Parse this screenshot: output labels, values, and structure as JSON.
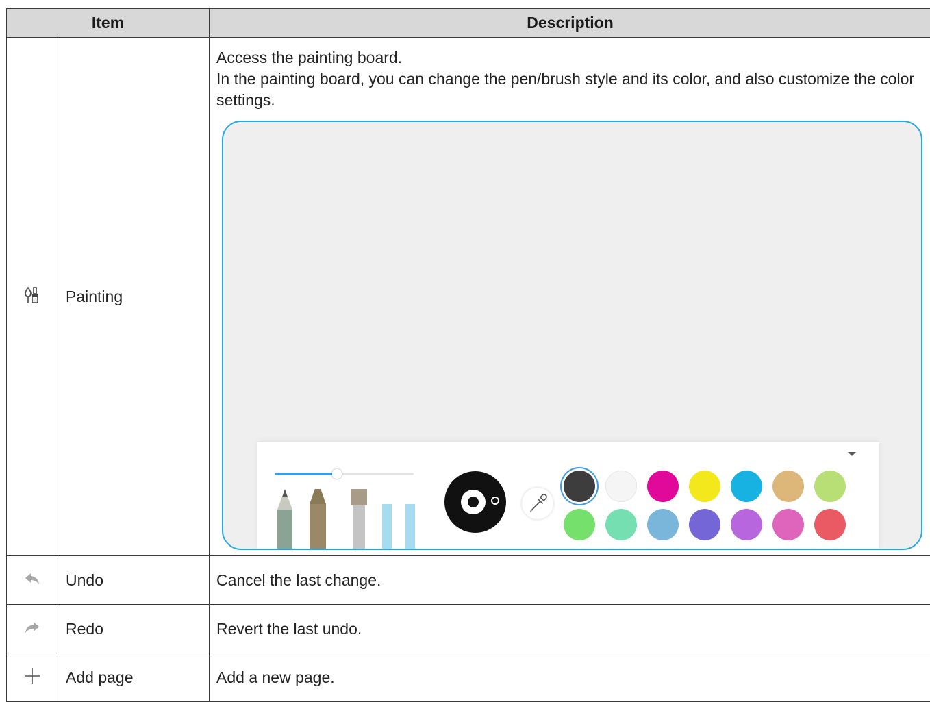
{
  "table": {
    "header": {
      "item": "Item",
      "description": "Description"
    },
    "rows": [
      {
        "icon": "painting-icon",
        "name": "Painting",
        "description_lines": [
          "Access the painting board.",
          "In the painting board, you can change the pen/brush style and its color, and also customize the color settings."
        ]
      },
      {
        "icon": "undo-icon",
        "name": "Undo",
        "description": "Cancel the last change."
      },
      {
        "icon": "redo-icon",
        "name": "Redo",
        "description": "Revert the last undo."
      },
      {
        "icon": "add-page-icon",
        "name": "Add page",
        "description": "Add a new page."
      }
    ]
  },
  "painting_board": {
    "stroke_size_level": 0.45,
    "selected_color": "#3d3d3d",
    "colors": [
      "#3d3d3d",
      "#f5f5f5",
      "#e0099a",
      "#f3e81c",
      "#18b2e2",
      "#ddb77a",
      "#b8de76",
      "#75e06c",
      "#75dfb1",
      "#7ab6da",
      "#7566d8",
      "#b866de",
      "#df64bc",
      "#e95a64"
    ],
    "pen_tools": [
      "pencil",
      "pen",
      "brush",
      "highlighter"
    ]
  }
}
